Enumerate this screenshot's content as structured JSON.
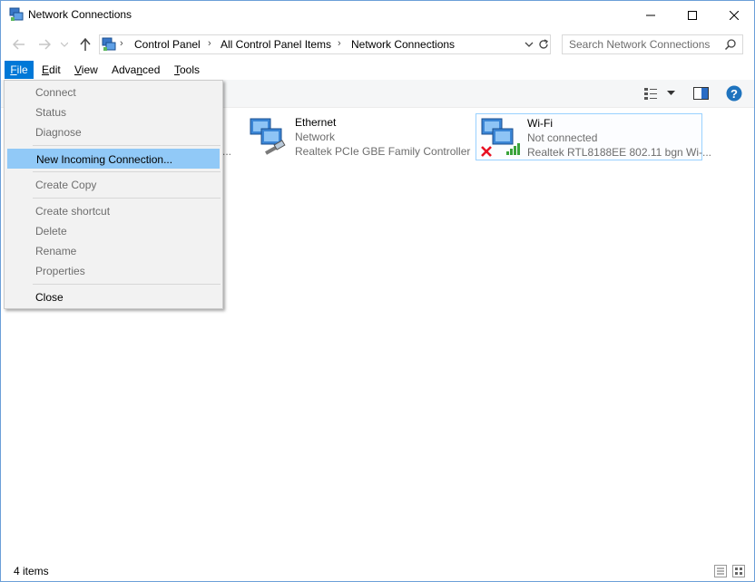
{
  "window": {
    "title": "Network Connections"
  },
  "address": {
    "crumbs": [
      "Control Panel",
      "All Control Panel Items",
      "Network Connections"
    ]
  },
  "search": {
    "placeholder": "Search Network Connections"
  },
  "menubar": [
    {
      "pre": "",
      "key": "F",
      "post": "ile"
    },
    {
      "pre": "",
      "key": "E",
      "post": "dit"
    },
    {
      "pre": "",
      "key": "V",
      "post": "iew"
    },
    {
      "pre": "Adva",
      "key": "n",
      "post": "ced"
    },
    {
      "pre": "",
      "key": "T",
      "post": "ools"
    }
  ],
  "file_menu": {
    "connect": "Connect",
    "status": "Status",
    "diagnose": "Diagnose",
    "new_incoming": "New Incoming Connection...",
    "create_copy": "Create Copy",
    "create_shortcut": "Create shortcut",
    "delete": "Delete",
    "rename": "Rename",
    "properties": "Properties",
    "close": "Close"
  },
  "connections": [
    {
      "name": "Ethernet",
      "status": "Network",
      "adapter": "Realtek PCIe GBE Family Controller"
    },
    {
      "name": "Wi-Fi",
      "status": "Not connected",
      "adapter": "Realtek RTL8188EE 802.11 bgn Wi-..."
    }
  ],
  "hidden_item_fragment": "...",
  "statusbar": {
    "count": "4 items"
  },
  "colors": {
    "accent": "#0078d7",
    "hover": "#91c9f7",
    "help": "#1e73be"
  }
}
